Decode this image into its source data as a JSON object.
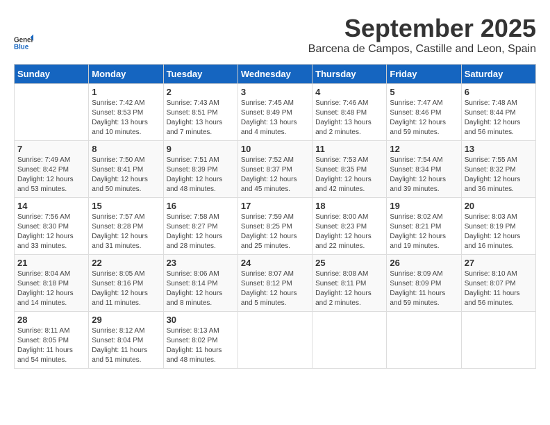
{
  "header": {
    "logo_line1": "General",
    "logo_line2": "Blue",
    "month_title": "September 2025",
    "location": "Barcena de Campos, Castille and Leon, Spain"
  },
  "weekdays": [
    "Sunday",
    "Monday",
    "Tuesday",
    "Wednesday",
    "Thursday",
    "Friday",
    "Saturday"
  ],
  "weeks": [
    [
      {
        "day": "",
        "info": ""
      },
      {
        "day": "1",
        "info": "Sunrise: 7:42 AM\nSunset: 8:53 PM\nDaylight: 13 hours\nand 10 minutes."
      },
      {
        "day": "2",
        "info": "Sunrise: 7:43 AM\nSunset: 8:51 PM\nDaylight: 13 hours\nand 7 minutes."
      },
      {
        "day": "3",
        "info": "Sunrise: 7:45 AM\nSunset: 8:49 PM\nDaylight: 13 hours\nand 4 minutes."
      },
      {
        "day": "4",
        "info": "Sunrise: 7:46 AM\nSunset: 8:48 PM\nDaylight: 13 hours\nand 2 minutes."
      },
      {
        "day": "5",
        "info": "Sunrise: 7:47 AM\nSunset: 8:46 PM\nDaylight: 12 hours\nand 59 minutes."
      },
      {
        "day": "6",
        "info": "Sunrise: 7:48 AM\nSunset: 8:44 PM\nDaylight: 12 hours\nand 56 minutes."
      }
    ],
    [
      {
        "day": "7",
        "info": "Sunrise: 7:49 AM\nSunset: 8:42 PM\nDaylight: 12 hours\nand 53 minutes."
      },
      {
        "day": "8",
        "info": "Sunrise: 7:50 AM\nSunset: 8:41 PM\nDaylight: 12 hours\nand 50 minutes."
      },
      {
        "day": "9",
        "info": "Sunrise: 7:51 AM\nSunset: 8:39 PM\nDaylight: 12 hours\nand 48 minutes."
      },
      {
        "day": "10",
        "info": "Sunrise: 7:52 AM\nSunset: 8:37 PM\nDaylight: 12 hours\nand 45 minutes."
      },
      {
        "day": "11",
        "info": "Sunrise: 7:53 AM\nSunset: 8:35 PM\nDaylight: 12 hours\nand 42 minutes."
      },
      {
        "day": "12",
        "info": "Sunrise: 7:54 AM\nSunset: 8:34 PM\nDaylight: 12 hours\nand 39 minutes."
      },
      {
        "day": "13",
        "info": "Sunrise: 7:55 AM\nSunset: 8:32 PM\nDaylight: 12 hours\nand 36 minutes."
      }
    ],
    [
      {
        "day": "14",
        "info": "Sunrise: 7:56 AM\nSunset: 8:30 PM\nDaylight: 12 hours\nand 33 minutes."
      },
      {
        "day": "15",
        "info": "Sunrise: 7:57 AM\nSunset: 8:28 PM\nDaylight: 12 hours\nand 31 minutes."
      },
      {
        "day": "16",
        "info": "Sunrise: 7:58 AM\nSunset: 8:27 PM\nDaylight: 12 hours\nand 28 minutes."
      },
      {
        "day": "17",
        "info": "Sunrise: 7:59 AM\nSunset: 8:25 PM\nDaylight: 12 hours\nand 25 minutes."
      },
      {
        "day": "18",
        "info": "Sunrise: 8:00 AM\nSunset: 8:23 PM\nDaylight: 12 hours\nand 22 minutes."
      },
      {
        "day": "19",
        "info": "Sunrise: 8:02 AM\nSunset: 8:21 PM\nDaylight: 12 hours\nand 19 minutes."
      },
      {
        "day": "20",
        "info": "Sunrise: 8:03 AM\nSunset: 8:19 PM\nDaylight: 12 hours\nand 16 minutes."
      }
    ],
    [
      {
        "day": "21",
        "info": "Sunrise: 8:04 AM\nSunset: 8:18 PM\nDaylight: 12 hours\nand 14 minutes."
      },
      {
        "day": "22",
        "info": "Sunrise: 8:05 AM\nSunset: 8:16 PM\nDaylight: 12 hours\nand 11 minutes."
      },
      {
        "day": "23",
        "info": "Sunrise: 8:06 AM\nSunset: 8:14 PM\nDaylight: 12 hours\nand 8 minutes."
      },
      {
        "day": "24",
        "info": "Sunrise: 8:07 AM\nSunset: 8:12 PM\nDaylight: 12 hours\nand 5 minutes."
      },
      {
        "day": "25",
        "info": "Sunrise: 8:08 AM\nSunset: 8:11 PM\nDaylight: 12 hours\nand 2 minutes."
      },
      {
        "day": "26",
        "info": "Sunrise: 8:09 AM\nSunset: 8:09 PM\nDaylight: 11 hours\nand 59 minutes."
      },
      {
        "day": "27",
        "info": "Sunrise: 8:10 AM\nSunset: 8:07 PM\nDaylight: 11 hours\nand 56 minutes."
      }
    ],
    [
      {
        "day": "28",
        "info": "Sunrise: 8:11 AM\nSunset: 8:05 PM\nDaylight: 11 hours\nand 54 minutes."
      },
      {
        "day": "29",
        "info": "Sunrise: 8:12 AM\nSunset: 8:04 PM\nDaylight: 11 hours\nand 51 minutes."
      },
      {
        "day": "30",
        "info": "Sunrise: 8:13 AM\nSunset: 8:02 PM\nDaylight: 11 hours\nand 48 minutes."
      },
      {
        "day": "",
        "info": ""
      },
      {
        "day": "",
        "info": ""
      },
      {
        "day": "",
        "info": ""
      },
      {
        "day": "",
        "info": ""
      }
    ]
  ]
}
